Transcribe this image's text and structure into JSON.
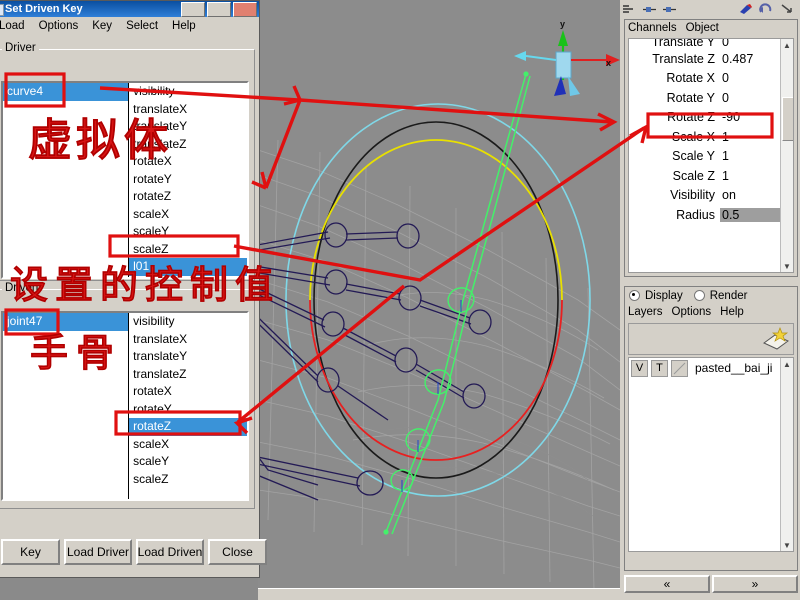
{
  "window": {
    "title": "Set Driven Key",
    "menus": [
      "Load",
      "Options",
      "Key",
      "Select",
      "Help"
    ],
    "driver": {
      "group_label": "Driver",
      "nodes": [
        "curve4"
      ],
      "node_selected_index": 0,
      "attributes": [
        "visibility",
        "translateX",
        "translateY",
        "translateZ",
        "rotateX",
        "rotateY",
        "rotateZ",
        "scaleX",
        "scaleY",
        "scaleZ",
        "l01"
      ],
      "attr_selected_index": 10
    },
    "driven": {
      "group_label": "Driven",
      "nodes": [
        "joint47"
      ],
      "node_selected_index": 0,
      "attributes": [
        "visibility",
        "translateX",
        "translateY",
        "translateZ",
        "rotateX",
        "rotateY",
        "rotateZ",
        "scaleX",
        "scaleY",
        "scaleZ"
      ],
      "attr_selected_index": 6
    },
    "buttons": [
      "Key",
      "Load Driver",
      "Load Driven",
      "Close"
    ]
  },
  "channel_box": {
    "menus": [
      "Channels",
      "Object"
    ],
    "clipped_top_row": {
      "name": "Translate Y",
      "value": "0"
    },
    "rows": [
      {
        "name": "Translate Z",
        "value": "0.487",
        "locked": false
      },
      {
        "name": "Rotate X",
        "value": "0",
        "locked": false
      },
      {
        "name": "Rotate Y",
        "value": "0",
        "locked": false
      },
      {
        "name": "Rotate Z",
        "value": "-90",
        "locked": false
      },
      {
        "name": "Scale X",
        "value": "1",
        "locked": false
      },
      {
        "name": "Scale Y",
        "value": "1",
        "locked": false
      },
      {
        "name": "Scale Z",
        "value": "1",
        "locked": false
      },
      {
        "name": "Visibility",
        "value": "on",
        "locked": false
      },
      {
        "name": "Radius",
        "value": "0.5",
        "locked": true
      }
    ]
  },
  "layer_editor": {
    "radios": [
      {
        "label": "Display",
        "selected": true
      },
      {
        "label": "Render",
        "selected": false
      }
    ],
    "menus": [
      "Layers",
      "Options",
      "Help"
    ],
    "columns": [
      "V",
      "T"
    ],
    "layers": [
      {
        "v": "V",
        "t": "T",
        "name": "pasted__bai_ji"
      }
    ]
  },
  "nav": {
    "prev": "«",
    "next": "»"
  },
  "annotations": [
    {
      "id": "virtual-body",
      "text": "虚拟体"
    },
    {
      "id": "control-value",
      "text": "设置的控制值"
    },
    {
      "id": "hand-bone",
      "text": "手骨"
    }
  ],
  "viewport": {
    "axis_gizmo": {
      "x_label": "x",
      "y_label": "y"
    }
  },
  "colors": {
    "annotation_red": "#d81414",
    "selection_blue": "#3a93d8",
    "panel_gray": "#d4d0c8",
    "viewport_gray": "#8c8c8c",
    "manipulator_green": "#44f06a",
    "manipulator_cyan": "#7fd8e8",
    "manipulator_yellow": "#e8e000",
    "manipulator_red": "#e82020"
  }
}
